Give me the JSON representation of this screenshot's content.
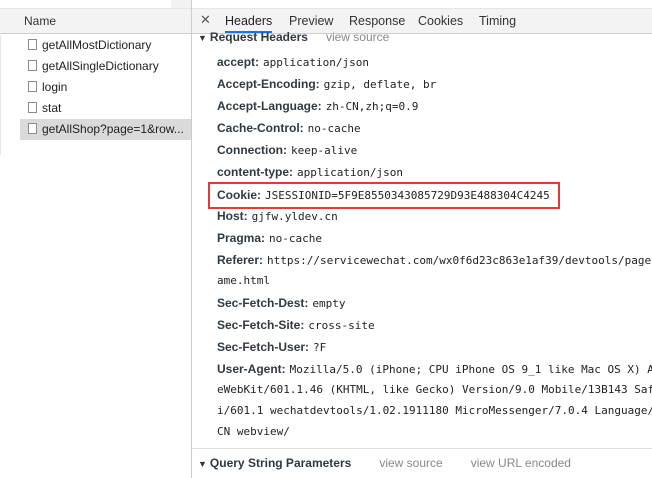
{
  "request_list": {
    "column_header": "Name",
    "items": [
      {
        "label": "getAllMostDictionary",
        "selected": false
      },
      {
        "label": "getAllSingleDictionary",
        "selected": false
      },
      {
        "label": "login",
        "selected": false
      },
      {
        "label": "stat",
        "selected": false
      },
      {
        "label": "getAllShop?page=1&row...",
        "selected": true
      }
    ]
  },
  "tabs": {
    "close": "✕",
    "headers": "Headers",
    "preview": "Preview",
    "response": "Response",
    "cookies": "Cookies",
    "timing": "Timing",
    "active": "Headers"
  },
  "request_headers": {
    "title": "Request Headers",
    "view_source": "view source",
    "rows": [
      {
        "key": "accept:",
        "value": "application/json"
      },
      {
        "key": "Accept-Encoding:",
        "value": "gzip, deflate, br"
      },
      {
        "key": "Accept-Language:",
        "value": "zh-CN,zh;q=0.9"
      },
      {
        "key": "Cache-Control:",
        "value": "no-cache"
      },
      {
        "key": "Connection:",
        "value": "keep-alive"
      },
      {
        "key": "content-type:",
        "value": "application/json"
      },
      {
        "key": "Cookie:",
        "value": "JSESSIONID=5F9E8550343085729D93E488304C4245"
      },
      {
        "key": "Host:",
        "value": "gjfw.yldev.cn"
      },
      {
        "key": "Pragma:",
        "value": "no-cache"
      },
      {
        "key": "Referer:",
        "value": "https://servicewechat.com/wx0f6d23c863e1af39/devtools/page"
      },
      {
        "key": "",
        "value": "ame.html"
      },
      {
        "key": "Sec-Fetch-Dest:",
        "value": "empty"
      },
      {
        "key": "Sec-Fetch-Site:",
        "value": "cross-site"
      },
      {
        "key": "Sec-Fetch-User:",
        "value": "?F"
      },
      {
        "key": "User-Agent:",
        "value": "Mozilla/5.0 (iPhone; CPU iPhone OS 9_1 like Mac OS X) A"
      },
      {
        "key": "",
        "value": "eWebKit/601.1.46 (KHTML, like Gecko) Version/9.0 Mobile/13B143 Saf"
      },
      {
        "key": "",
        "value": "i/601.1 wechatdevtools/1.02.1911180 MicroMessenger/7.0.4 Language/"
      },
      {
        "key": "",
        "value": "CN webview/"
      }
    ]
  },
  "query_string": {
    "title": "Query String Parameters",
    "view_source": "view source",
    "view_url_encoded": "view URL encoded"
  },
  "colors": {
    "highlight_border": "#e53935",
    "active_tab_underline": "#1a73e8",
    "selected_row": "#dadada"
  }
}
